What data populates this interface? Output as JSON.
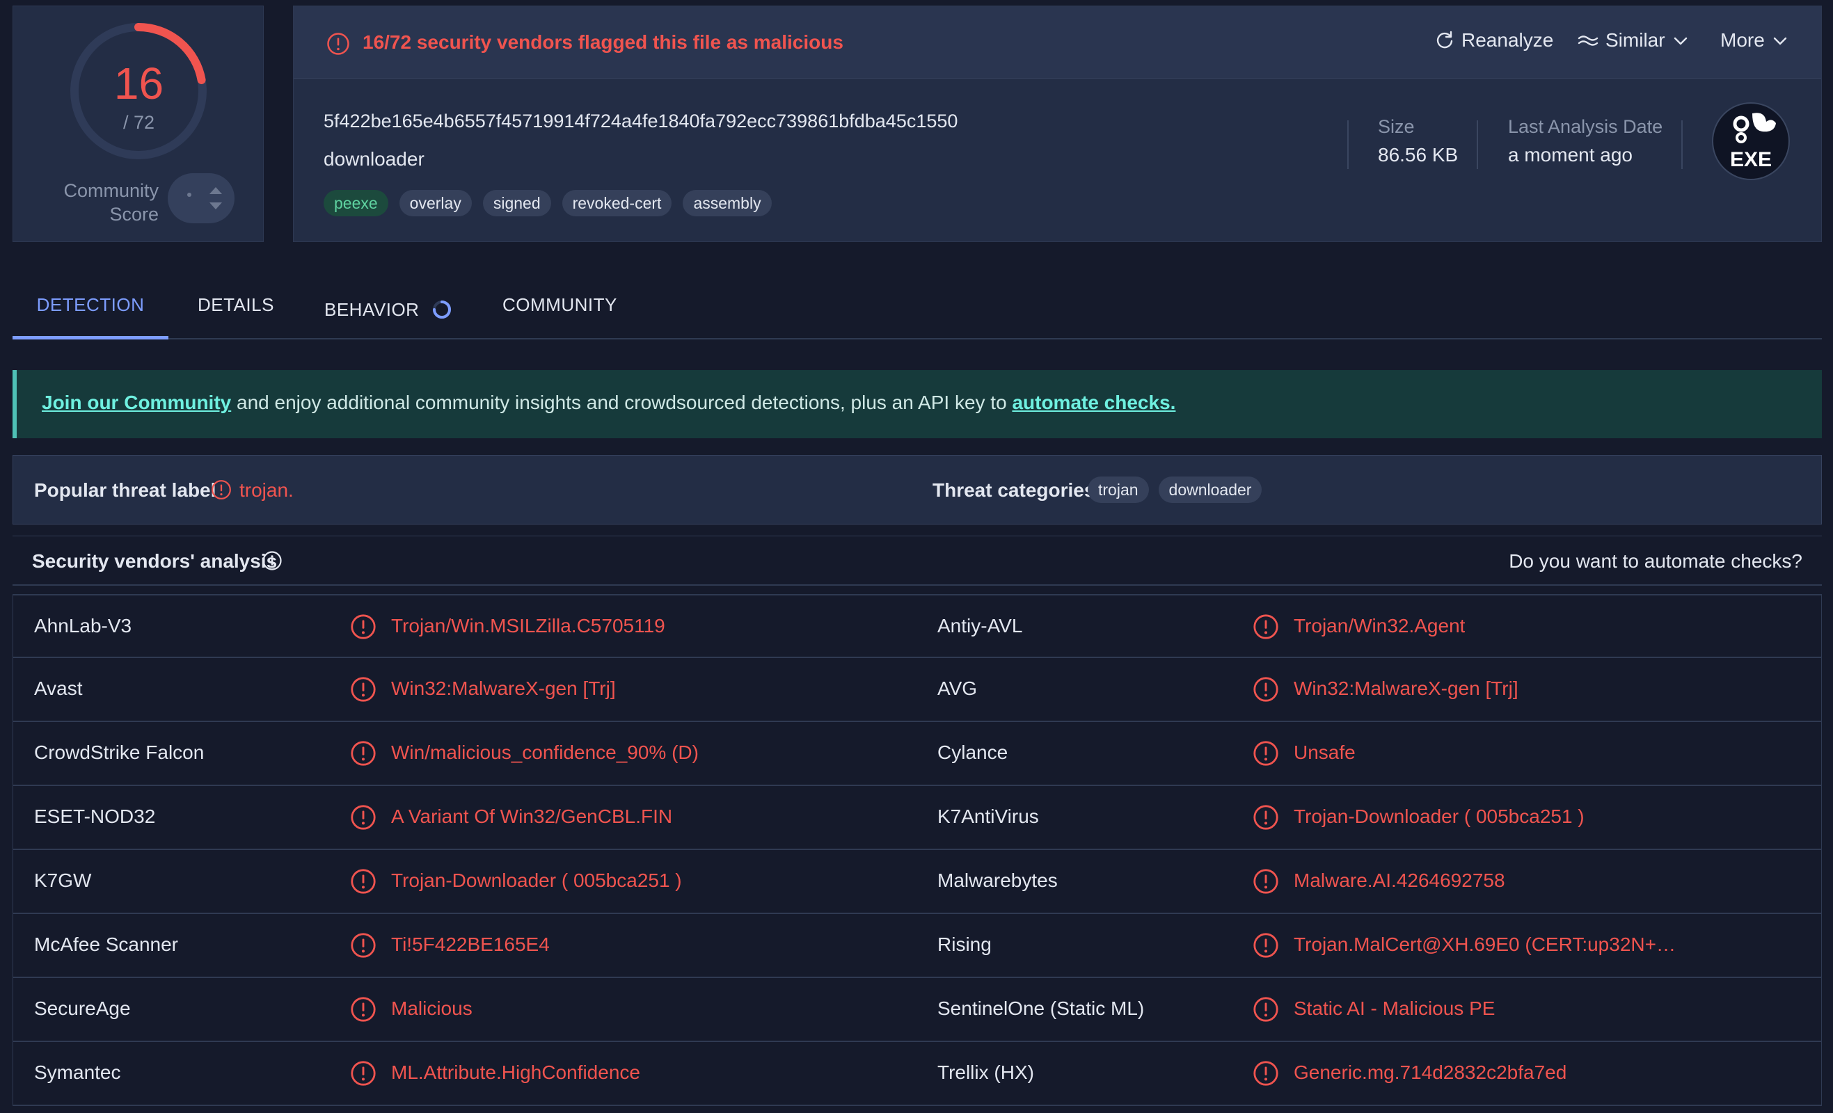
{
  "score": {
    "value": "16",
    "total": "/ 72",
    "label_line1": "Community",
    "label_line2": "Score",
    "fraction": 0.222
  },
  "alert": {
    "text": "16/72 security vendors flagged this file as malicious"
  },
  "actions": {
    "reanalyze": "Reanalyze",
    "similar": "Similar",
    "more": "More"
  },
  "file": {
    "hash": "5f422be165e4b6557f45719914f724a4fe1840fa792ecc739861bfdba45c1550",
    "name": "downloader",
    "tags": [
      "peexe",
      "overlay",
      "signed",
      "revoked-cert",
      "assembly"
    ],
    "size_label": "Size",
    "size_value": "86.56 KB",
    "date_label": "Last Analysis Date",
    "date_value": "a moment ago",
    "type_badge": "EXE"
  },
  "tabs": {
    "detection": "DETECTION",
    "details": "DETAILS",
    "behavior": "BEHAVIOR",
    "community": "COMMUNITY"
  },
  "banner": {
    "link1": "Join our Community",
    "middle": " and enjoy additional community insights and crowdsourced detections, plus an API key to ",
    "link2": "automate checks."
  },
  "threat": {
    "label_title": "Popular threat label",
    "label_value": "trojan.",
    "categories_title": "Threat categories",
    "categories": [
      "trojan",
      "downloader"
    ]
  },
  "vendors": {
    "title": "Security vendors' analysis",
    "automate": "Do you want to automate checks?",
    "rows": [
      {
        "left_name": "AhnLab-V3",
        "left_result": "Trojan/Win.MSILZilla.C5705119",
        "right_name": "Antiy-AVL",
        "right_result": "Trojan/Win32.Agent"
      },
      {
        "left_name": "Avast",
        "left_result": "Win32:MalwareX-gen [Trj]",
        "right_name": "AVG",
        "right_result": "Win32:MalwareX-gen [Trj]"
      },
      {
        "left_name": "CrowdStrike Falcon",
        "left_result": "Win/malicious_confidence_90% (D)",
        "right_name": "Cylance",
        "right_result": "Unsafe"
      },
      {
        "left_name": "ESET-NOD32",
        "left_result": "A Variant Of Win32/GenCBL.FIN",
        "right_name": "K7AntiVirus",
        "right_result": "Trojan-Downloader ( 005bca251 )"
      },
      {
        "left_name": "K7GW",
        "left_result": "Trojan-Downloader ( 005bca251 )",
        "right_name": "Malwarebytes",
        "right_result": "Malware.AI.4264692758"
      },
      {
        "left_name": "McAfee Scanner",
        "left_result": "Ti!5F422BE165E4",
        "right_name": "Rising",
        "right_result": "Trojan.MalCert@XH.69E0 (CERT:up32N+…"
      },
      {
        "left_name": "SecureAge",
        "left_result": "Malicious",
        "right_name": "SentinelOne (Static ML)",
        "right_result": "Static AI - Malicious PE"
      },
      {
        "left_name": "Symantec",
        "left_result": "ML.Attribute.HighConfidence",
        "right_name": "Trellix (HX)",
        "right_result": "Generic.mg.714d2832c2bfa7ed"
      }
    ]
  },
  "colors": {
    "malicious": "#f0544f",
    "accent": "#7d9dff",
    "banner_link": "#6ff0e0"
  }
}
